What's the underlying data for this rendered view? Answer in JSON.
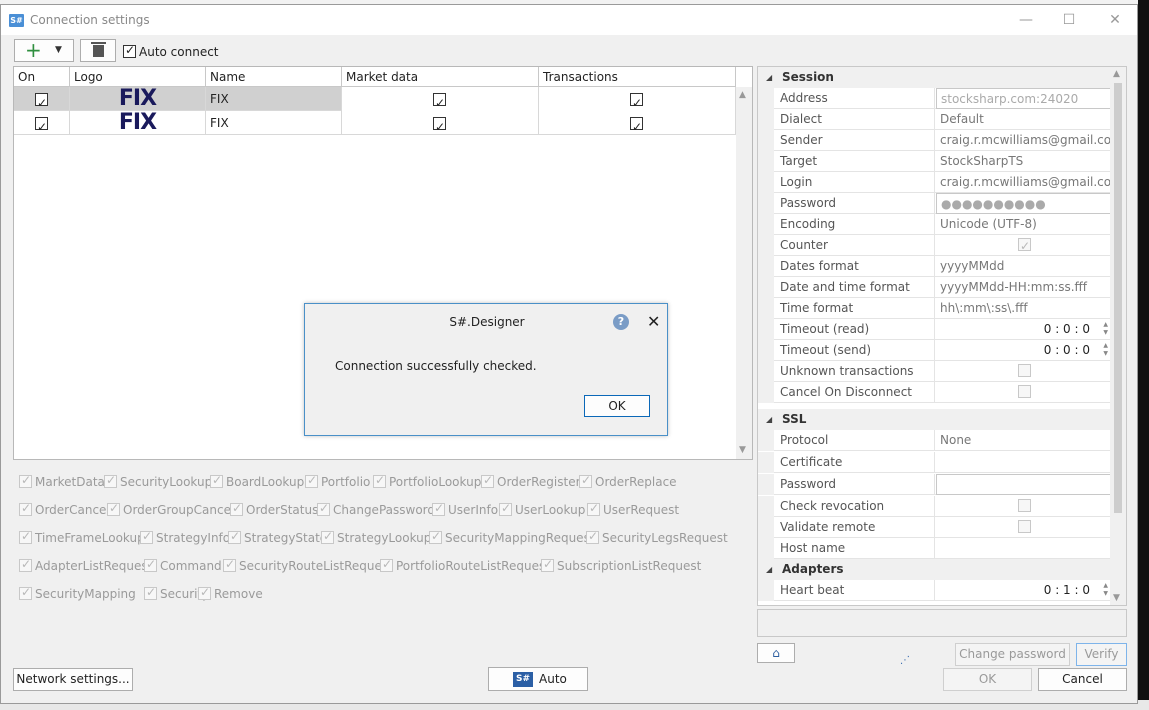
{
  "window": {
    "title": "Connection settings",
    "controls": {
      "minimize": "—",
      "maximize": "☐",
      "close": "✕"
    }
  },
  "toolbar": {
    "auto_connect_label": "Auto connect",
    "auto_connect_checked": true
  },
  "grid": {
    "columns": [
      "On",
      "Logo",
      "Name",
      "Market data",
      "Transactions"
    ],
    "rows": [
      {
        "on": true,
        "logo": "FIX",
        "name": "FIX",
        "market_data": true,
        "transactions": true,
        "selected": true
      },
      {
        "on": true,
        "logo": "FIX",
        "name": "FIX",
        "market_data": true,
        "transactions": true,
        "selected": false
      }
    ]
  },
  "capabilities": [
    "MarketData",
    "SecurityLookup",
    "BoardLookup",
    "Portfolio",
    "PortfolioLookup",
    "OrderRegister",
    "OrderReplace",
    "OrderCancel",
    "OrderGroupCancel",
    "OrderStatus",
    "ChangePassword",
    "UserInfo",
    "UserLookup",
    "UserRequest",
    "TimeFrameLookup",
    "StrategyInfo",
    "StrategyState",
    "StrategyLookup",
    "SecurityMappingRequest",
    "SecurityLegsRequest",
    "AdapterListRequest",
    "Command",
    "SecurityRouteListRequest",
    "PortfolioRouteListRequest",
    "SubscriptionListRequest",
    "SecurityMapping",
    "Security",
    "Remove"
  ],
  "dialog": {
    "title": "S#.Designer",
    "message": "Connection successfully checked.",
    "ok_label": "OK",
    "help_glyph": "?",
    "close_glyph": "✕"
  },
  "properties": {
    "session": {
      "label": "Session",
      "address": {
        "name": "Address",
        "value": "stocksharp.com:24020"
      },
      "dialect": {
        "name": "Dialect",
        "value": "Default"
      },
      "sender": {
        "name": "Sender",
        "value": "craig.r.mcwilliams@gmail.com"
      },
      "target": {
        "name": "Target",
        "value": "StockSharpTS"
      },
      "login": {
        "name": "Login",
        "value": "craig.r.mcwilliams@gmail.com"
      },
      "password": {
        "name": "Password",
        "value": "●●●●●●●●●●"
      },
      "encoding": {
        "name": "Encoding",
        "value": "Unicode (UTF-8)"
      },
      "counter": {
        "name": "Counter",
        "checked": true
      },
      "dates_format": {
        "name": "Dates format",
        "value": "yyyyMMdd"
      },
      "datetime_format": {
        "name": "Date and time format",
        "value": "yyyyMMdd-HH:mm:ss.fff"
      },
      "time_format": {
        "name": "Time format",
        "value": "hh\\:mm\\:ss\\.fff"
      },
      "timeout_read": {
        "name": "Timeout (read)",
        "value": "0 : 0 : 0"
      },
      "timeout_send": {
        "name": "Timeout (send)",
        "value": "0 : 0 : 0"
      },
      "unknown_transactions": {
        "name": "Unknown transactions",
        "checked": false
      },
      "cancel_on_disconnect": {
        "name": "Cancel On Disconnect",
        "checked": false
      }
    },
    "ssl": {
      "label": "SSL",
      "protocol": {
        "name": "Protocol",
        "value": "None"
      },
      "certificate": {
        "name": "Certificate",
        "value": ""
      },
      "password": {
        "name": "Password",
        "value": ""
      },
      "check_revocation": {
        "name": "Check revocation",
        "checked": false
      },
      "validate_remote": {
        "name": "Validate remote",
        "checked": false
      },
      "host_name": {
        "name": "Host name",
        "value": ""
      }
    },
    "adapters": {
      "label": "Adapters",
      "heart_beat": {
        "name": "Heart beat",
        "value": "0 : 1 : 0"
      }
    }
  },
  "footer": {
    "network_settings": "Network settings...",
    "auto": "Auto",
    "auto_logo": "S#",
    "change_password": "Change password",
    "verify": "Verify",
    "ok": "OK",
    "cancel": "Cancel"
  }
}
